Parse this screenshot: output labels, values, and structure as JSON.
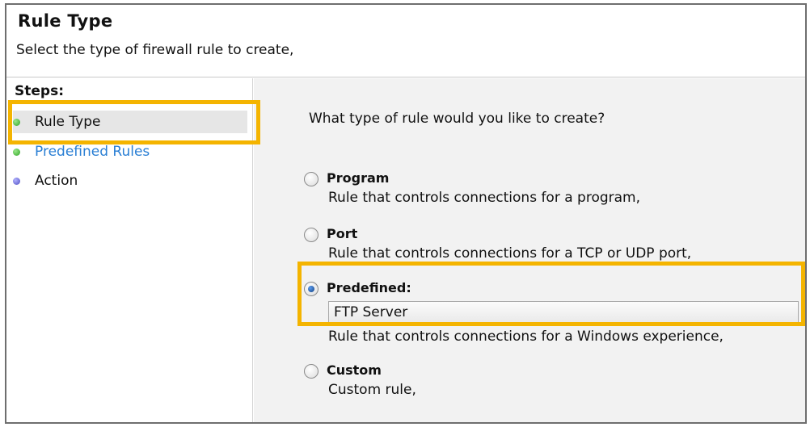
{
  "header": {
    "title": "Rule Type",
    "subtitle": "Select the type of firewall rule to create,"
  },
  "steps": {
    "heading": "Steps:",
    "items": [
      {
        "label": "Rule Type",
        "bullet": "green",
        "state": "current"
      },
      {
        "label": "Predefined Rules",
        "bullet": "green",
        "state": "link"
      },
      {
        "label": "Action",
        "bullet": "purple",
        "state": "normal"
      }
    ]
  },
  "main": {
    "question": "What type of rule would you like to create?",
    "options": [
      {
        "label": "Program",
        "description": "Rule that controls connections for a program,",
        "selected": false
      },
      {
        "label": "Port",
        "description": "Rule that controls connections for a TCP or UDP port,",
        "selected": false
      },
      {
        "label": "Predefined:",
        "description": "Rule that controls connections for a Windows experience,",
        "selected": true,
        "dropdown_value": "FTP Server"
      },
      {
        "label": "Custom",
        "description": "Custom rule,",
        "selected": false
      }
    ]
  },
  "colors": {
    "highlight": "#f4b400",
    "link": "#2a7fd4",
    "content_bg": "#f2f2f2"
  }
}
